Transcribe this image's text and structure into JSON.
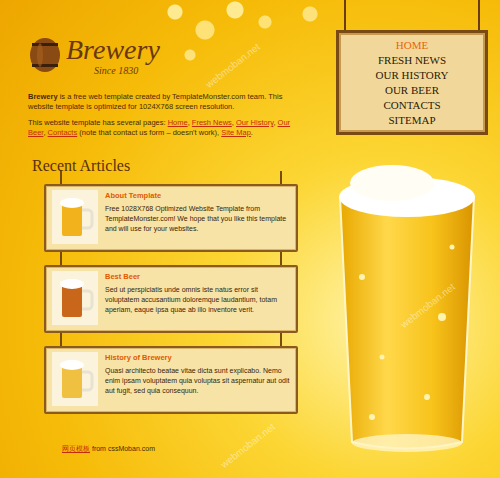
{
  "logo": {
    "name": "Brewery",
    "since": "Since 1830"
  },
  "intro": [
    [
      {
        "text": "Brewery",
        "kind": "bold"
      },
      {
        "text": " is a free web template created by TemplateMonster.com team. This website template is optimized for 1024X768 screen resolution.",
        "kind": "plain"
      }
    ],
    [
      {
        "text": "This website template has several pages: ",
        "kind": "plain"
      },
      {
        "text": "Home",
        "kind": "link"
      },
      {
        "text": ", ",
        "kind": "plain"
      },
      {
        "text": "Fresh News",
        "kind": "link"
      },
      {
        "text": ", ",
        "kind": "plain"
      },
      {
        "text": "Our History",
        "kind": "link"
      },
      {
        "text": ", ",
        "kind": "plain"
      },
      {
        "text": "Our Beer",
        "kind": "link"
      },
      {
        "text": ", ",
        "kind": "plain"
      },
      {
        "text": "Contacts",
        "kind": "link"
      },
      {
        "text": " (note that contact us form – doesn't work), ",
        "kind": "plain"
      },
      {
        "text": "Site Map",
        "kind": "link"
      },
      {
        "text": ".",
        "kind": "plain"
      }
    ]
  ],
  "nav": [
    {
      "label": "HOME",
      "selected": true
    },
    {
      "label": "FRESH NEWS",
      "selected": false
    },
    {
      "label": "OUR HISTORY",
      "selected": false
    },
    {
      "label": "OUR BEER",
      "selected": false
    },
    {
      "label": "CONTACTS",
      "selected": false
    },
    {
      "label": "SITEMAP",
      "selected": false
    }
  ],
  "recent": {
    "title": "Recent Articles",
    "articles": [
      {
        "title": "About Template",
        "body": "Free 1028X768 Optimized Website Template from TemplateMonster.com! We hope that you like this template and will use for your websites."
      },
      {
        "title": "Best Beer",
        "body": "Sed ut perspiciatis unde omnis iste natus error sit voluptatem accusantium doloremque laudantium, totam aperiam, eaque ipsa quae ab illo inventore verit."
      },
      {
        "title": "History of Brewery",
        "body": "Quasi architecto beatae vitae dicta sunt explicabo. Nemo enim ipsam voluptatem quia voluptas sit aspernatur aut odit aut fugit, sed quia consequun."
      }
    ]
  },
  "footer": [
    {
      "text": "网页模板",
      "kind": "link"
    },
    {
      "text": " from cssMoban.com",
      "kind": "plain"
    }
  ],
  "watermark": "webmoban.net"
}
